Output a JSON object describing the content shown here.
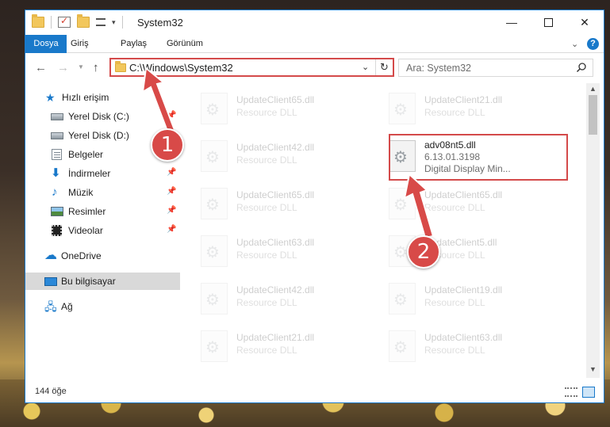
{
  "window": {
    "title": "System32"
  },
  "ribbon": {
    "tabs": [
      "Dosya",
      "Giriş",
      "Paylaş",
      "Görünüm"
    ]
  },
  "address": {
    "path": "C:\\Windows\\System32"
  },
  "search": {
    "placeholder": "Ara: System32"
  },
  "sidebar": {
    "items": [
      {
        "label": "Hızlı erişim",
        "icon": "star-icon"
      },
      {
        "label": "Yerel Disk (C:)",
        "icon": "drive-icon",
        "pinned": true
      },
      {
        "label": "Yerel Disk (D:)",
        "icon": "drive-icon",
        "pinned": false
      },
      {
        "label": "Belgeler",
        "icon": "documents-icon",
        "pinned": true
      },
      {
        "label": "İndirmeler",
        "icon": "downloads-icon",
        "pinned": true
      },
      {
        "label": "Müzik",
        "icon": "music-icon",
        "pinned": true
      },
      {
        "label": "Resimler",
        "icon": "pictures-icon",
        "pinned": true
      },
      {
        "label": "Videolar",
        "icon": "videos-icon",
        "pinned": true
      },
      {
        "label": "OneDrive",
        "icon": "onedrive-icon"
      },
      {
        "label": "Bu bilgisayar",
        "icon": "computer-icon",
        "selected": true
      },
      {
        "label": "Ağ",
        "icon": "network-icon"
      }
    ]
  },
  "files": [
    {
      "name": "UpdateClient65.dll",
      "desc": "Resource DLL",
      "faded": true
    },
    {
      "name": "UpdateClient21.dll",
      "desc": "Resource DLL",
      "faded": true
    },
    {
      "name": "UpdateClient42.dll",
      "desc": "Resource DLL",
      "faded": true
    },
    {
      "name": "adv08nt5.dll",
      "version": "6.13.01.3198",
      "desc": "Digital Display Min...",
      "faded": false
    },
    {
      "name": "UpdateClient65.dll",
      "desc": "Resource DLL",
      "faded": true
    },
    {
      "name": "UpdateClient65.dll",
      "desc": "Resource DLL",
      "faded": true
    },
    {
      "name": "UpdateClient63.dll",
      "desc": "Resource DLL",
      "faded": true
    },
    {
      "name": "UpdateClient5.dll",
      "desc": "Resource DLL",
      "faded": true
    },
    {
      "name": "UpdateClient42.dll",
      "desc": "Resource DLL",
      "faded": true
    },
    {
      "name": "UpdateClient19.dll",
      "desc": "Resource DLL",
      "faded": true
    },
    {
      "name": "UpdateClient21.dll",
      "desc": "Resource DLL",
      "faded": true
    },
    {
      "name": "UpdateClient63.dll",
      "desc": "Resource DLL",
      "faded": true
    }
  ],
  "status": {
    "count": "144 öğe"
  },
  "callouts": [
    "1",
    "2"
  ],
  "colors": {
    "accent": "#1979ca",
    "highlight": "#d44a4a"
  }
}
